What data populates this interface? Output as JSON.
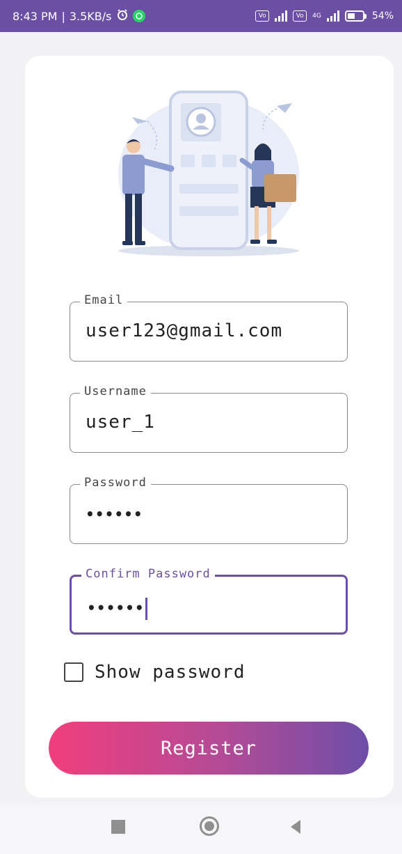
{
  "status_bar": {
    "time": "8:43 PM",
    "separator": "|",
    "speed": "3.5KB/s",
    "volte1": "Vo",
    "volte2": "Vo",
    "network_gen": "4G",
    "battery": "54%"
  },
  "form": {
    "email_label": "Email",
    "email_value": "user123@gmail.com",
    "username_label": "Username",
    "username_value": "user_1",
    "password_label": "Password",
    "password_value": "••••••",
    "confirm_label": "Confirm Password",
    "confirm_value": "••••••",
    "show_password_label": "Show password",
    "show_password_checked": false,
    "register_label": "Register"
  },
  "colors": {
    "status_bar": "#6a4fa4",
    "accent": "#6a4fa4",
    "button_start": "#f13e7d",
    "button_end": "#6d4ea8"
  },
  "icons": {
    "alarm": "alarm-icon",
    "whatsapp": "whatsapp-icon",
    "signal": "signal-icon",
    "battery": "battery-icon",
    "nav_recent": "recent-apps-icon",
    "nav_home": "home-icon",
    "nav_back": "back-icon"
  }
}
